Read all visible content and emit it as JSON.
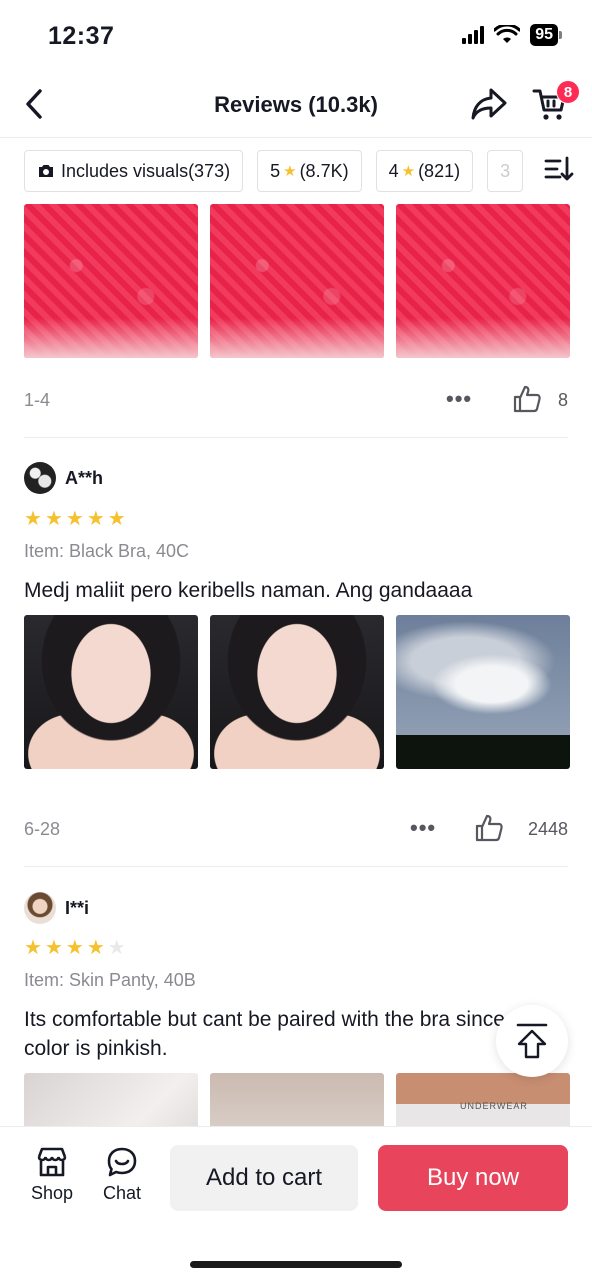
{
  "status": {
    "time": "12:37",
    "battery": "95"
  },
  "header": {
    "title": "Reviews (10.3k)",
    "cart_count": "8"
  },
  "filters": [
    {
      "label": "Includes visuals(373)",
      "icon": "camera-icon"
    },
    {
      "prefix": "5",
      "star": "★",
      "label": "(8.7K)"
    },
    {
      "prefix": "4",
      "star": "★",
      "label": "(821)"
    },
    {
      "label": "3"
    }
  ],
  "review_prev": {
    "date": "1-4",
    "more": "•••",
    "likes": "8"
  },
  "reviews": [
    {
      "name": "A**h",
      "rating": 5,
      "item": "Item: Black Bra, 40C",
      "text": "Medj maliit pero keribells naman. Ang gandaaaa",
      "date": "6-28",
      "more": "•••",
      "likes": "2448"
    },
    {
      "name": "I**i",
      "rating": 4,
      "item": "Item: Skin Panty, 40B",
      "text": "Its comfortable but cant be paired with the bra since the color is pinkish.",
      "package_text": "UNDERWEAR"
    }
  ],
  "bottom": {
    "shop_label": "Shop",
    "chat_label": "Chat",
    "add_to_cart": "Add to cart",
    "buy_now": "Buy now"
  },
  "colors": {
    "accent": "#fe2c55",
    "buy_button": "#e8455d",
    "star": "#f5c12e"
  }
}
